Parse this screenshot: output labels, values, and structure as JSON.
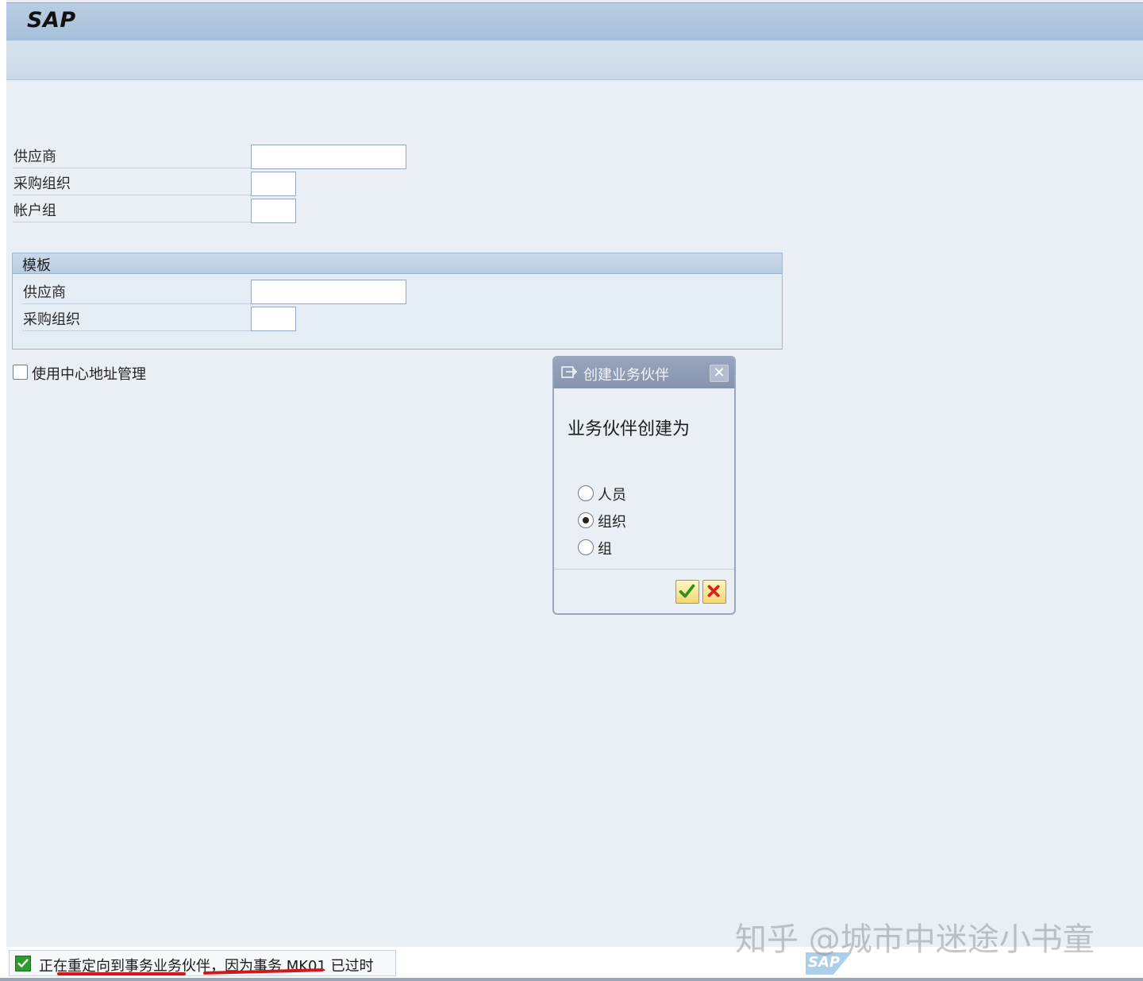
{
  "app": {
    "title": "SAP"
  },
  "form": {
    "vendor_label": "供应商",
    "purch_org_label": "采购组织",
    "account_group_label": "帐户组",
    "vendor_value": "",
    "purch_org_value": "",
    "account_group_value": ""
  },
  "template_group": {
    "title": "模板",
    "vendor_label": "供应商",
    "purch_org_label": "采购组织",
    "vendor_value": "",
    "purch_org_value": ""
  },
  "central_address": {
    "label": "使用中心地址管理",
    "checked": false
  },
  "dialog": {
    "title": "创建业务伙伴",
    "heading": "业务伙伴创建为",
    "options": [
      {
        "label": "人员",
        "selected": false
      },
      {
        "label": "组织",
        "selected": true
      },
      {
        "label": "组",
        "selected": false
      }
    ],
    "confirm_icon": "check-icon",
    "cancel_icon": "cancel-x-icon"
  },
  "status": {
    "message": "正在重定向到事务业务伙伴，因为事务 MK01 已过时",
    "type_icon": "success-check-icon"
  },
  "watermark": {
    "text": "知乎 @城市中迷途小书童",
    "logo": "SAP"
  },
  "colors": {
    "annotation_underline": "#d4171b",
    "status_success": "#2f9b2f"
  }
}
